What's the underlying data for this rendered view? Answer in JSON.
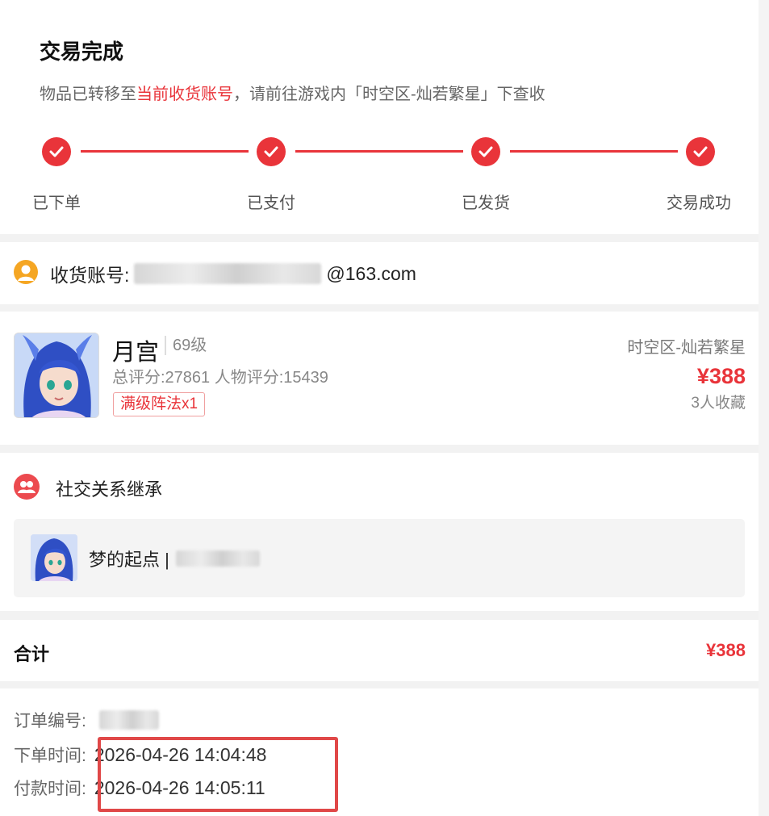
{
  "status": {
    "title": "交易完成",
    "desc_prefix": "物品已转移至",
    "desc_highlight": "当前收货账号",
    "desc_suffix": "，请前往游戏内「时空区-灿若繁星」下查收",
    "steps": [
      "已下单",
      "已支付",
      "已发货",
      "交易成功"
    ]
  },
  "account": {
    "label": "收货账号:",
    "suffix": "@163.com"
  },
  "role": {
    "name": "月宫",
    "level": "69级",
    "score": "总评分:27861 人物评分:15439",
    "badge": "满级阵法x1",
    "server": "时空区-灿若繁星",
    "price": "¥388",
    "favorites": "3人收藏"
  },
  "social": {
    "title": "社交关系继承",
    "name": "梦的起点 |"
  },
  "total": {
    "label": "合计",
    "value": "¥388"
  },
  "order": {
    "id_label": "订单编号:",
    "created_label": "下单时间:",
    "created_value": "2026-04-26 14:04:48",
    "paid_label": "付款时间:",
    "paid_value": "2026-04-26 14:05:11"
  },
  "colors": {
    "accent": "#e9343a",
    "highlight_box": "#e04848"
  }
}
